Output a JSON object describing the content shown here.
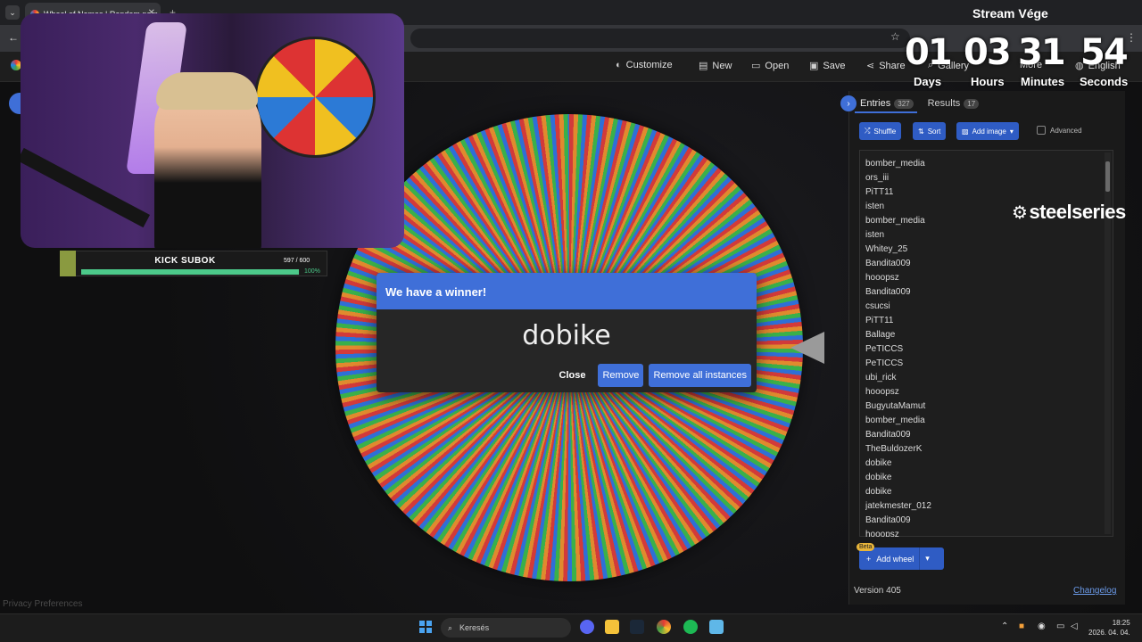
{
  "browser": {
    "tab_title": "Wheel of Names | Random nam"
  },
  "menu": {
    "customize": "Customize",
    "new": "New",
    "open": "Open",
    "save": "Save",
    "share": "Share",
    "gallery": "Gallery",
    "more": "More",
    "language": "English"
  },
  "dialog": {
    "title": "We have a winner!",
    "winner": "dobike",
    "close": "Close",
    "remove": "Remove",
    "remove_all": "Remove all instances"
  },
  "panel": {
    "tab_entries": "Entries",
    "entries_count": "327",
    "tab_results": "Results",
    "results_count": "17",
    "shuffle": "Shuffle",
    "sort": "Sort",
    "add_image": "Add image",
    "advanced": "Advanced",
    "entries": [
      "bomber_media",
      "ors_iii",
      "PiTT11",
      "isten",
      "bomber_media",
      "isten",
      "Whitey_25",
      "Bandita009",
      "hooopsz",
      "Bandita009",
      "csucsi",
      "PiTT11",
      "Ballage",
      "PeTICCS",
      "PeTICCS",
      "ubi_rick",
      "hooopsz",
      "BugyutaMamut",
      "bomber_media",
      "Bandita009",
      "TheBuldozerK",
      "dobike",
      "dobike",
      "dobike",
      "jatekmester_012",
      "Bandita009",
      "hooopsz"
    ],
    "beta": "Beta",
    "add_wheel": "Add wheel",
    "version": "Version 405",
    "changelog": "Changelog"
  },
  "privacy": "Privacy Preferences",
  "kick": {
    "title": "KICK SUBOK",
    "count": "597 / 600",
    "percent_label": "100%",
    "progress": 0.995
  },
  "countdown": {
    "title": "Stream Vége",
    "days": "01",
    "hours": "03",
    "minutes": "31",
    "seconds": "54",
    "days_label": "Days",
    "hours_label": "Hours",
    "minutes_label": "Minutes",
    "seconds_label": "Seconds"
  },
  "sponsor": "steelseries",
  "taskbar": {
    "search": "Keresés",
    "time": "18:25",
    "date": "2026. 04. 04."
  }
}
